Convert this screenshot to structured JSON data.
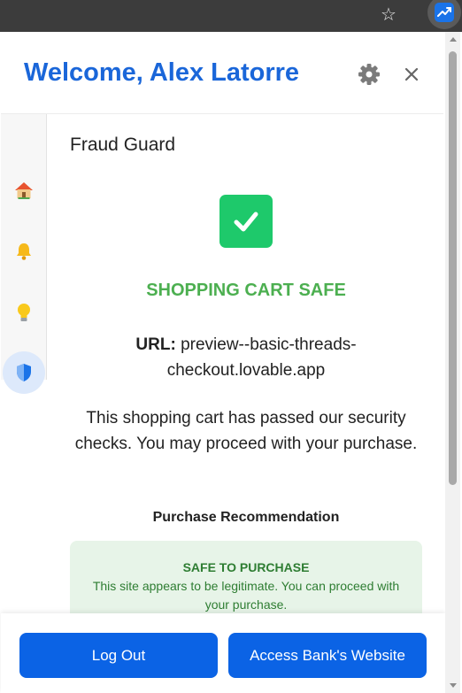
{
  "browser": {
    "star_icon": "star-icon",
    "extension_icon": "trend-chart-icon"
  },
  "header": {
    "welcome": "Welcome, Alex Latorre",
    "settings_icon": "gear-icon",
    "close_icon": "close-icon"
  },
  "sidebar": {
    "items": [
      {
        "icon": "home-icon",
        "active": false
      },
      {
        "icon": "bell-icon",
        "active": false
      },
      {
        "icon": "lightbulb-icon",
        "active": false
      },
      {
        "icon": "shield-icon",
        "active": true
      }
    ]
  },
  "main": {
    "section_title": "Fraud Guard",
    "status_icon": "checkmark-icon",
    "status_title": "SHOPPING CART SAFE",
    "url_label": "URL:",
    "url_value": "preview--basic-threads-checkout.lovable.app",
    "description": "This shopping cart has passed our security checks. You may proceed with your purchase.",
    "recommendation_heading": "Purchase Recommendation",
    "recommendation_title": "SAFE TO PURCHASE",
    "recommendation_text": "This site appears to be legitimate. You can proceed with your purchase."
  },
  "footer": {
    "logout_label": "Log Out",
    "bank_label": "Access Bank's Website"
  },
  "colors": {
    "brand_blue": "#1a66d9",
    "button_blue": "#0b63e5",
    "safe_green": "#4caf50",
    "check_green": "#1ec96b",
    "card_green_bg": "#e7f4e8",
    "card_green_text": "#2e7d32"
  }
}
